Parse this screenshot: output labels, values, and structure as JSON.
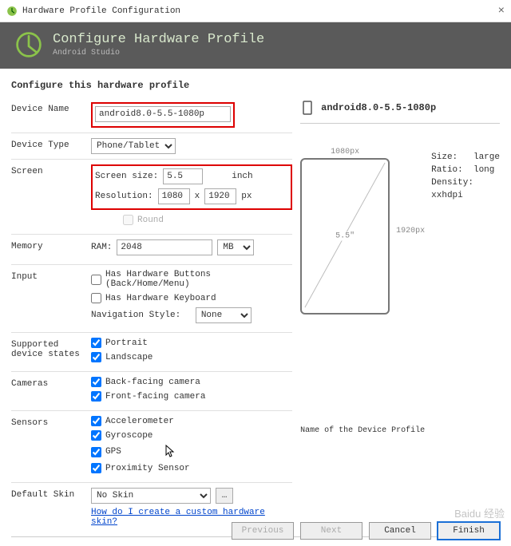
{
  "window": {
    "title": "Hardware Profile Configuration"
  },
  "header": {
    "title": "Configure Hardware Profile",
    "subtitle": "Android Studio"
  },
  "section_title": "Configure this hardware profile",
  "labels": {
    "device_name": "Device Name",
    "device_type": "Device Type",
    "screen": "Screen",
    "screen_size": "Screen size:",
    "resolution": "Resolution:",
    "inch": "inch",
    "px": "px",
    "x": "x",
    "round": "Round",
    "memory": "Memory",
    "ram": "RAM:",
    "input": "Input",
    "hw_buttons": "Has Hardware Buttons (Back/Home/Menu)",
    "hw_keyboard": "Has Hardware Keyboard",
    "nav_style": "Navigation Style:",
    "supported_states": "Supported\ndevice states",
    "portrait": "Portrait",
    "landscape": "Landscape",
    "cameras": "Cameras",
    "back_cam": "Back-facing camera",
    "front_cam": "Front-facing camera",
    "sensors": "Sensors",
    "accel": "Accelerometer",
    "gyro": "Gyroscope",
    "gps": "GPS",
    "prox": "Proximity Sensor",
    "default_skin": "Default Skin",
    "skin_link": "How do I create a custom hardware skin?"
  },
  "values": {
    "device_name": "android8.0-5.5-1080p",
    "device_type": "Phone/Tablet",
    "screen_size": "5.5",
    "res_w": "1080",
    "res_h": "1920",
    "round": false,
    "ram": "2048",
    "ram_unit": "MB",
    "hw_buttons": false,
    "hw_keyboard": false,
    "nav_style": "None",
    "portrait": true,
    "landscape": true,
    "back_cam": true,
    "front_cam": true,
    "accel": true,
    "gyro": true,
    "gps": true,
    "prox": true,
    "skin": "No Skin"
  },
  "preview": {
    "name": "android8.0-5.5-1080p",
    "width_label": "1080px",
    "height_label": "1920px",
    "diag": "5.5\"",
    "size": "Size:",
    "size_val": "large",
    "ratio": "Ratio:",
    "ratio_val": "long",
    "density": "Density:",
    "density_val": "xxhdpi",
    "footer": "Name of the Device Profile"
  },
  "buttons": {
    "previous": "Previous",
    "next": "Next",
    "cancel": "Cancel",
    "finish": "Finish"
  }
}
